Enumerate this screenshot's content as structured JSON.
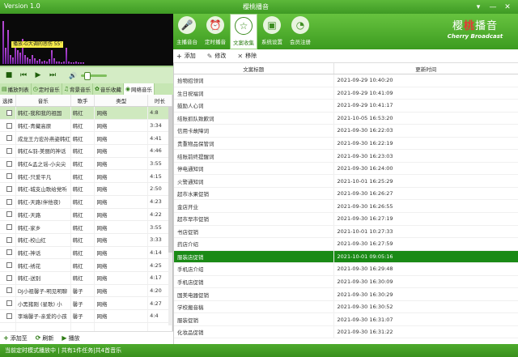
{
  "titlebar": {
    "version": "Version 1.0",
    "title": "樱桃播音",
    "controls": [
      "▾",
      "—",
      "✕"
    ]
  },
  "spectrum": {
    "song_label": "播放-G大调的悲伤 55'",
    "levels": [
      0.95,
      0.35,
      0.75,
      0.2,
      0.15,
      0.45,
      0.3,
      0.25,
      0.55,
      0.2,
      0.15,
      0.1,
      0.2,
      0.12,
      0.08,
      0.1,
      0.06,
      0.08,
      0.05,
      0.1,
      0.3,
      0.12,
      0.06,
      0.05,
      0.04,
      0.06,
      0.35,
      0.05,
      0.04,
      0.03,
      0.05,
      0.04,
      0.03,
      0.04
    ]
  },
  "player": {
    "buttons": [
      "■",
      "⏮",
      "▶",
      "⏭"
    ],
    "volume_icon": "🔊"
  },
  "left_tabs": [
    {
      "icon": "▤",
      "label": "播放列表"
    },
    {
      "icon": "◷",
      "label": "定时音乐"
    },
    {
      "icon": "♫",
      "label": "背景音乐"
    },
    {
      "icon": "✿",
      "label": "音乐收藏"
    },
    {
      "icon": "◉",
      "label": "网络音乐"
    }
  ],
  "left_table": {
    "headers": [
      "选择",
      "音乐",
      "歌手",
      "类型",
      "时长"
    ],
    "rows": [
      [
        "韩红-我和我的祖国",
        "韩红",
        "网络",
        "4:8"
      ],
      [
        "韩红-青藏高原",
        "韩红",
        "网络",
        "3:34"
      ],
      [
        "成龙王力宏孙燕姿韩红",
        "韩红",
        "网络",
        "4:41"
      ],
      [
        "韩红&羽-美丽的神话",
        "韩红",
        "网络",
        "4:46"
      ],
      [
        "韩红&孟之谣-小尖尖",
        "韩红",
        "网络",
        "3:55"
      ],
      [
        "韩红-只爱平凡",
        "韩红",
        "网络",
        "4:15"
      ],
      [
        "韩红-城支山歌给党听",
        "韩红",
        "网络",
        "2:50"
      ],
      [
        "韩红-天路(伴他夜)",
        "韩红",
        "网络",
        "4:23"
      ],
      [
        "韩红-天路",
        "韩红",
        "网络",
        "4:22"
      ],
      [
        "韩红-家乡",
        "韩红",
        "网络",
        "3:55"
      ],
      [
        "韩红-校山红",
        "韩红",
        "网络",
        "3:33"
      ],
      [
        "韩红-神话",
        "韩红",
        "网络",
        "4:14"
      ],
      [
        "韩红-绣花",
        "韩红",
        "网络",
        "4:25"
      ],
      [
        "韩红-送别",
        "韩红",
        "网络",
        "4:17"
      ],
      [
        "DJ小祖馨子-明见明聊",
        "馨子",
        "网络",
        "4:20"
      ],
      [
        "小黑猪刚 (星歌) 小",
        "馨子",
        "网络",
        "4:27"
      ],
      [
        "李端馨子-亲爱的小孩",
        "馨子",
        "网络",
        "4:4"
      ],
      [
        "",
        "",
        "",
        ""
      ]
    ]
  },
  "left_bottom": [
    {
      "icon": "+",
      "label": "添加至"
    },
    {
      "icon": "⟳",
      "label": "刷新"
    },
    {
      "icon": "▶",
      "label": "播放"
    }
  ],
  "toolbar_tabs": [
    {
      "icon": "🎤",
      "label": "主播音台"
    },
    {
      "icon": "⏰",
      "label": "定时播音"
    },
    {
      "icon": "☆",
      "label": "文案收集"
    },
    {
      "icon": "▣",
      "label": "系统设置"
    },
    {
      "icon": "◔",
      "label": "会员注册"
    }
  ],
  "logo": {
    "cn_a": "樱",
    "cn_b": "桃",
    "cn_c": "播音",
    "en": "Cherry Broadcast"
  },
  "right_tools": [
    {
      "icon": "+",
      "label": "添加"
    },
    {
      "icon": "✎",
      "label": "修改"
    },
    {
      "icon": "✕",
      "label": "移除"
    }
  ],
  "right_table": {
    "headers": [
      "文案标题",
      "更新时间"
    ],
    "rows": [
      [
        "拾物招领词",
        "2021-09-29 10:40:20"
      ],
      [
        "生日祝福词",
        "2021-09-29 10:41:09"
      ],
      [
        "鼓励人心词",
        "2021-09-29 10:41:17"
      ],
      [
        "结账抓队致歉词",
        "2021-10-05 16:53:20"
      ],
      [
        "信用卡故障词",
        "2021-09-30 16:22:03"
      ],
      [
        "贵重物品保管词",
        "2021-09-30 16:22:19"
      ],
      [
        "结账前终提醒词",
        "2021-09-30 16:23:03"
      ],
      [
        "停电通知词",
        "2021-09-30 16:24:00"
      ],
      [
        "火警通知词",
        "2021-10-01 16:25:29"
      ],
      [
        "超市水果促销",
        "2021-09-30 16:26:27"
      ],
      [
        "金店开业",
        "2021-09-30 16:26:55"
      ],
      [
        "超市早市促销",
        "2021-09-30 16:27:19"
      ],
      [
        "书店促销",
        "2021-10-01 10:27:33"
      ],
      [
        "药店介绍",
        "2021-09-30 16:27:59"
      ],
      [
        "服装店促销",
        "2021-10-01 09:05:16"
      ],
      [
        "手机店介绍",
        "2021-09-30 16:29:48"
      ],
      [
        "手机店促销",
        "2021-09-30 16:30:09"
      ],
      [
        "国美电器促销",
        "2021-09-30 16:30:29"
      ],
      [
        "学校搬音稿",
        "2021-09-30 16:30:52"
      ],
      [
        "服装促销",
        "2021-09-30 16:31:07"
      ],
      [
        "化妆品促销",
        "2021-09-30 16:31:22"
      ]
    ],
    "selected_index": 14
  },
  "status": {
    "text": "当前定时模式播放中 | 共有1件任务|共4首音乐"
  }
}
